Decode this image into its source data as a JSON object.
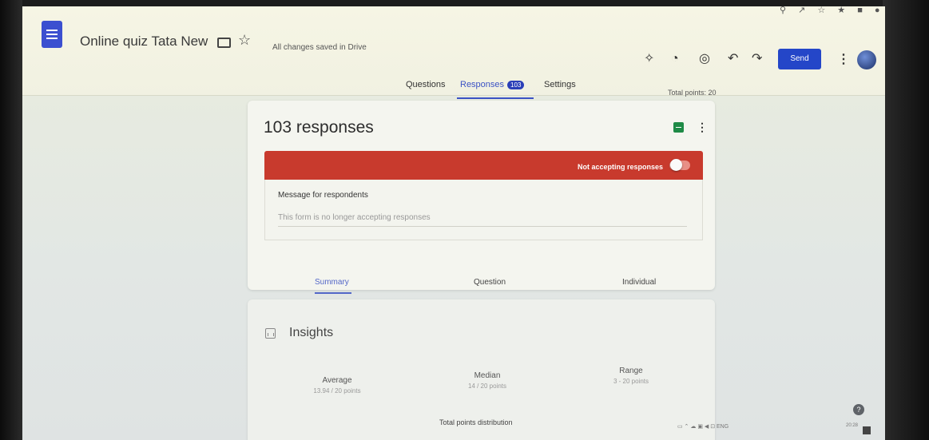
{
  "header": {
    "title": "Online quiz Tata New",
    "save_status": "All changes saved in Drive",
    "send_label": "Send"
  },
  "tabs": {
    "questions": "Questions",
    "responses": "Responses",
    "responses_count": "103",
    "settings": "Settings"
  },
  "total_points": "Total points: 20",
  "responses": {
    "title": "103 responses",
    "banner_text": "Not accepting responses",
    "message_label": "Message for respondents",
    "message_text": "This form is no longer accepting responses",
    "view_tabs": [
      "Summary",
      "Question",
      "Individual"
    ]
  },
  "insights": {
    "title": "Insights",
    "stats": [
      {
        "label": "Average",
        "value": "13.94 / 20 points"
      },
      {
        "label": "Median",
        "value": "14 / 20 points"
      },
      {
        "label": "Range",
        "value": "3 - 20 points"
      }
    ],
    "distribution_title": "Total points distribution"
  },
  "taskbar": {
    "lang": "ENG",
    "time": "20:28"
  },
  "colors": {
    "accent": "#3b52c4",
    "banner": "#c83a2d",
    "send": "#2446c8"
  },
  "icons": [
    "forms-icon",
    "folder-icon",
    "star-icon",
    "addon-icon",
    "palette-icon",
    "preview-icon",
    "undo-icon",
    "redo-icon",
    "more-icon",
    "avatar",
    "sheets-icon",
    "insights-icon",
    "help-icon"
  ]
}
